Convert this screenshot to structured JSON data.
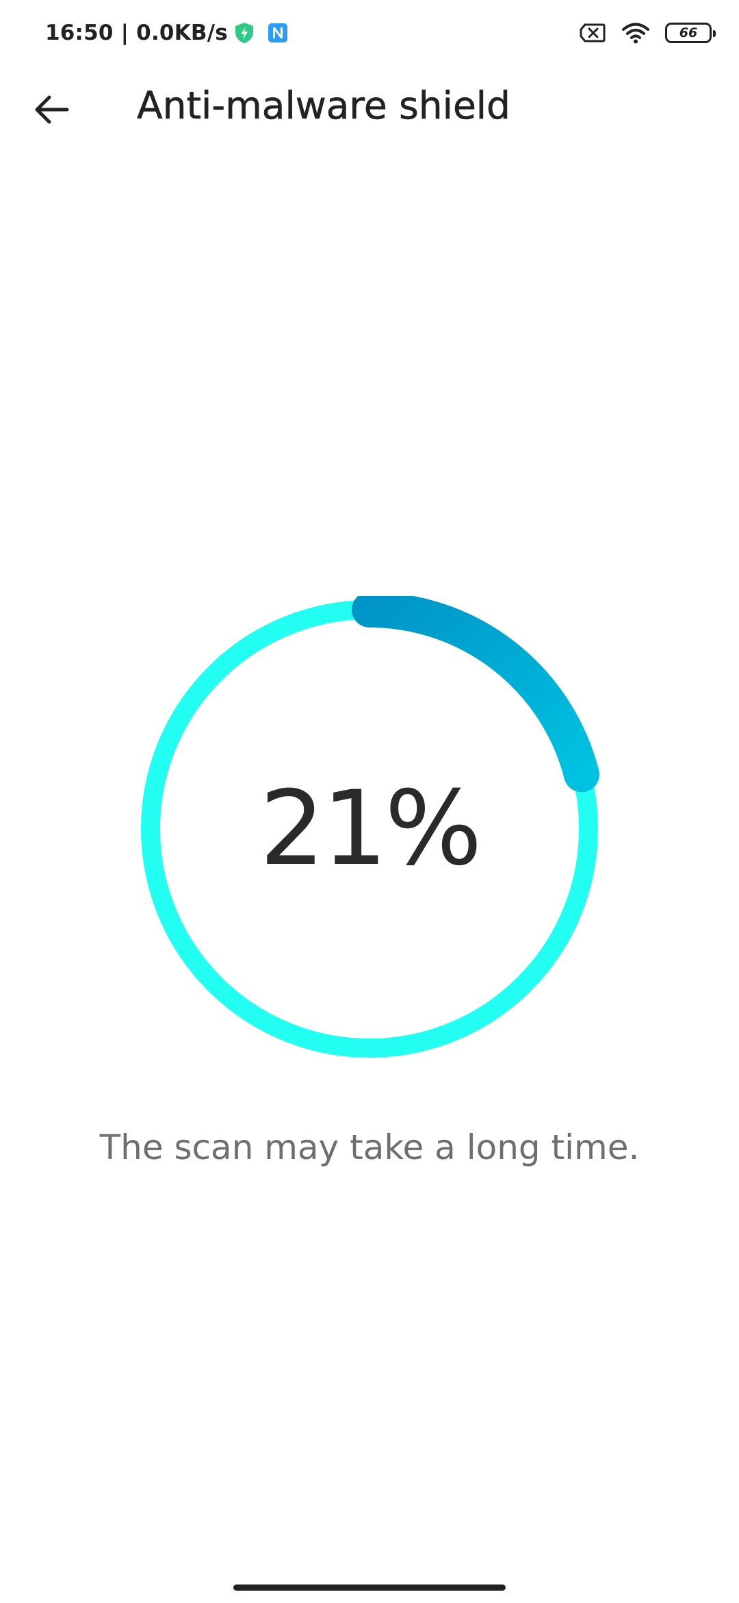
{
  "status_bar": {
    "time_speed": "16:50 | 0.0KB/s",
    "icons": [
      "shield-bolt-icon",
      "n-app-icon",
      "no-sim-icon",
      "wifi-icon",
      "battery-icon"
    ],
    "battery_level": "66"
  },
  "header": {
    "back_icon": "arrow-left-icon",
    "title": "Anti-malware shield"
  },
  "scan": {
    "progress_label": "21%",
    "progress_fraction": 0.21,
    "note": "The scan may take a long time."
  },
  "colors": {
    "track": "#22FFF2",
    "progress_start": "#0095C8",
    "progress_end": "#00C2E0",
    "shield_icon": "#2DCB84",
    "n_app_icon": "#2A9DF4"
  }
}
